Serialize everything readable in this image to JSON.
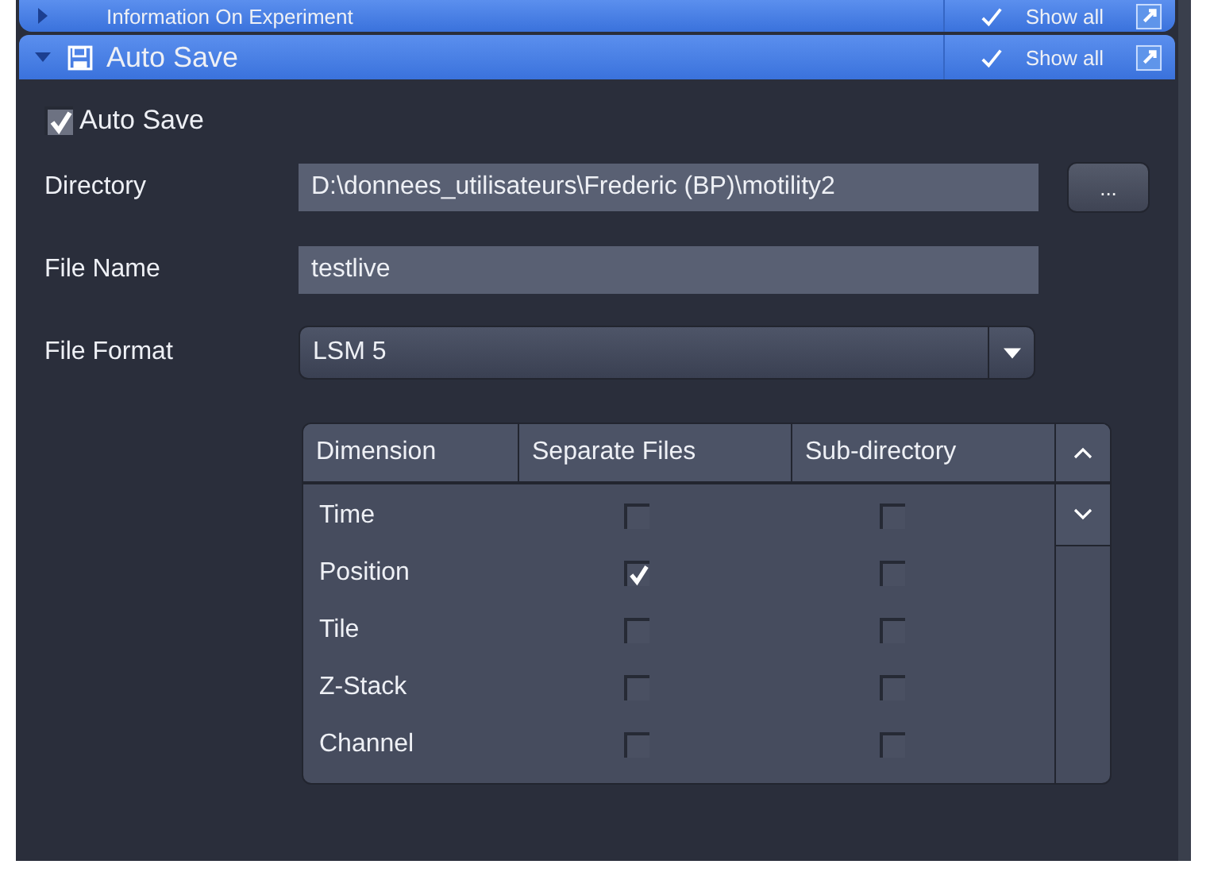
{
  "sections": [
    {
      "title": "Information On Experiment",
      "expanded": false,
      "show_all": "Show all",
      "show_all_checked": true
    },
    {
      "title": "Auto Save",
      "expanded": true,
      "show_all": "Show all",
      "show_all_checked": true
    }
  ],
  "auto_save": {
    "label": "Auto Save",
    "checked": true
  },
  "fields": [
    {
      "kind": "text",
      "label": "Directory",
      "value": "D:\\donnees_utilisateurs\\Frederic (BP)\\motility2",
      "button": "..."
    },
    {
      "kind": "text",
      "label": "File Name",
      "value": "testlive"
    },
    {
      "kind": "dropdown",
      "label": "File Format",
      "value": "LSM 5"
    }
  ],
  "table": {
    "columns": [
      "Dimension",
      "Separate Files",
      "Sub-directory"
    ],
    "rows": [
      {
        "name": "Time",
        "separate_files": false,
        "sub_directory": false
      },
      {
        "name": "Position",
        "separate_files": true,
        "sub_directory": false
      },
      {
        "name": "Tile",
        "separate_files": false,
        "sub_directory": false
      },
      {
        "name": "Z-Stack",
        "separate_files": false,
        "sub_directory": false
      },
      {
        "name": "Channel",
        "separate_files": false,
        "sub_directory": false
      }
    ]
  }
}
